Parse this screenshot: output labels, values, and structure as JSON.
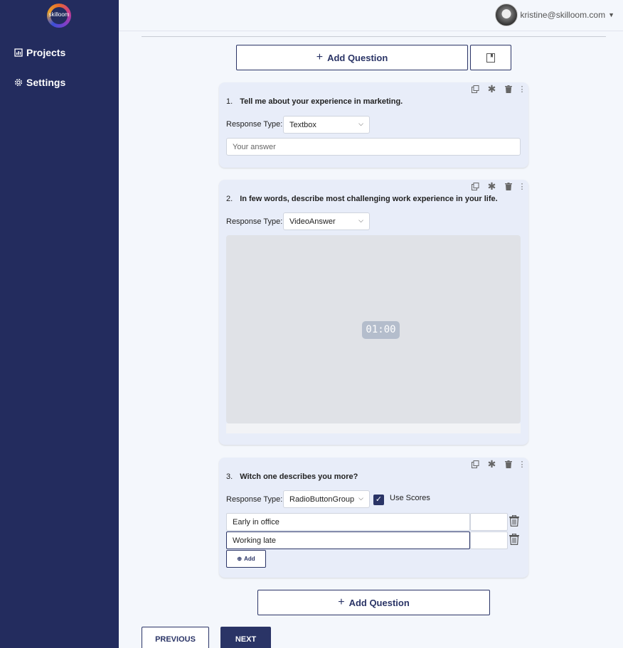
{
  "brand": {
    "logo_text": "skilloom"
  },
  "sidebar": {
    "items": [
      {
        "label": "Projects",
        "icon": "chart-icon"
      },
      {
        "label": "Settings",
        "icon": "gear-icon"
      }
    ]
  },
  "user": {
    "email": "kristine@skilloom.com"
  },
  "toolbar": {
    "add_question_label": "Add Question",
    "bookmark_icon": "bookmark-icon"
  },
  "questions": [
    {
      "number": "1.",
      "text": "Tell me about your experience in marketing.",
      "response_type_label": "Response Type:",
      "response_type": "Textbox",
      "answer_placeholder": "Your answer"
    },
    {
      "number": "2.",
      "text": "In few words, describe most challenging work experience in your life.",
      "response_type_label": "Response Type:",
      "response_type": "VideoAnswer",
      "timer": "01:00"
    },
    {
      "number": "3.",
      "text": "Witch one describes you more?",
      "response_type_label": "Response Type:",
      "response_type": "RadioButtonGroup",
      "use_scores_label": "Use Scores",
      "use_scores": true,
      "options": [
        "Early in office",
        "Working late"
      ],
      "add_option_label": "Add"
    }
  ],
  "footer": {
    "add_question_label": "Add Question",
    "previous_label": "PREVIOUS",
    "next_label": "NEXT"
  },
  "colors": {
    "sidebar": "#232c5e",
    "accent": "#2a3466",
    "card": "#e8edf9"
  }
}
